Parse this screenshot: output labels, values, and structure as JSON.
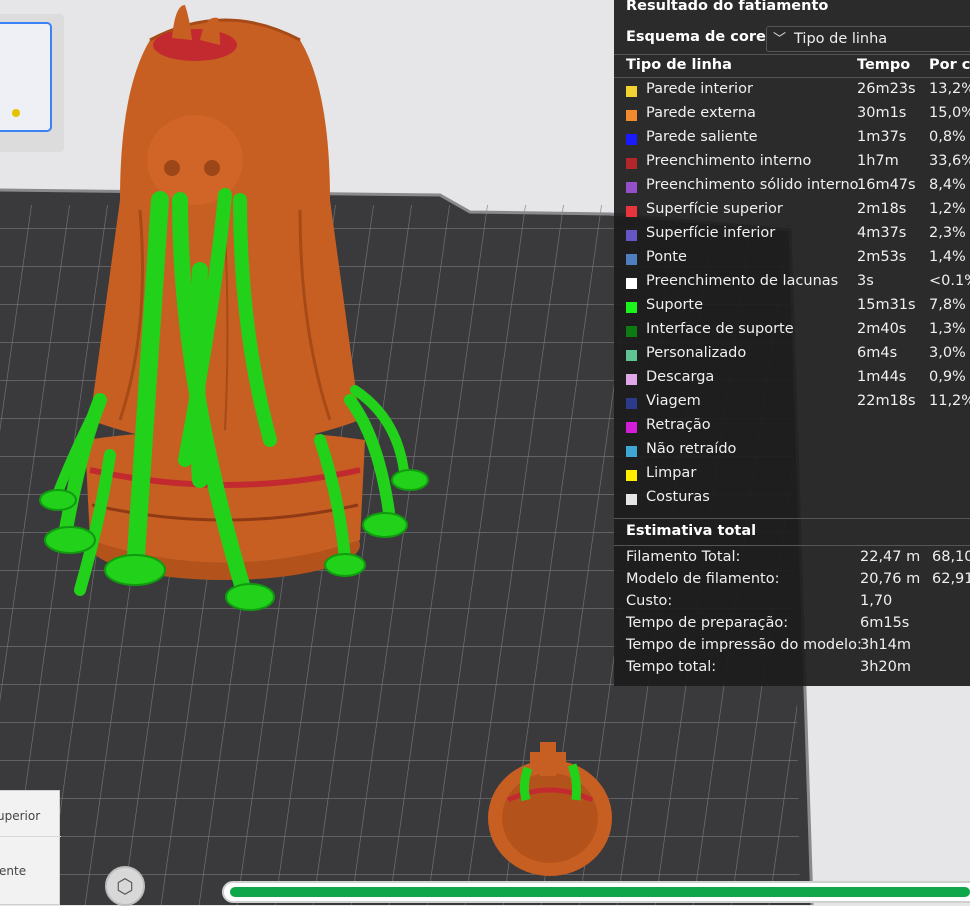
{
  "panel": {
    "title": "Resultado do fatiamento",
    "color_scheme_label": "Esquema de cores",
    "color_scheme_value": "Tipo de linha",
    "headers": {
      "line_type": "Tipo de linha",
      "time": "Tempo",
      "percent": "Por ce"
    },
    "rows": [
      {
        "label": "Parede interior",
        "time": "26m23s",
        "percent": "13,2%",
        "color": "#f2d233"
      },
      {
        "label": "Parede externa",
        "time": "30m1s",
        "percent": "15,0%",
        "color": "#f28a2e"
      },
      {
        "label": "Parede saliente",
        "time": "1m37s",
        "percent": "0,8%",
        "color": "#1a1aff"
      },
      {
        "label": "Preenchimento interno",
        "time": "1h7m",
        "percent": "33,6%",
        "color": "#b3262c"
      },
      {
        "label": "Preenchimento sólido interno",
        "time": "16m47s",
        "percent": "8,4%",
        "color": "#9450c8"
      },
      {
        "label": "Superfície superior",
        "time": "2m18s",
        "percent": "1,2%",
        "color": "#e8343d"
      },
      {
        "label": "Superfície inferior",
        "time": "4m37s",
        "percent": "2,3%",
        "color": "#6655c4"
      },
      {
        "label": "Ponte",
        "time": "2m53s",
        "percent": "1,4%",
        "color": "#4f7fbf"
      },
      {
        "label": "Preenchimento de lacunas",
        "time": "3s",
        "percent": "<0.1%",
        "color": "#ffffff"
      },
      {
        "label": "Suporte",
        "time": "15m31s",
        "percent": "7,8%",
        "color": "#1cf21c"
      },
      {
        "label": "Interface de suporte",
        "time": "2m40s",
        "percent": "1,3%",
        "color": "#0d7a12"
      },
      {
        "label": "Personalizado",
        "time": "6m4s",
        "percent": "3,0%",
        "color": "#5ec493"
      },
      {
        "label": "Descarga",
        "time": "1m44s",
        "percent": "0,9%",
        "color": "#dfa6e8"
      },
      {
        "label": "Viagem",
        "time": "22m18s",
        "percent": "11,2%",
        "color": "#2c3a8c"
      },
      {
        "label": "Retração",
        "time": "",
        "percent": "",
        "color": "#d21ed8"
      },
      {
        "label": "Não retraído",
        "time": "",
        "percent": "",
        "color": "#3fa7d6"
      },
      {
        "label": "Limpar",
        "time": "",
        "percent": "",
        "color": "#ffee00"
      },
      {
        "label": "Costuras",
        "time": "",
        "percent": "",
        "color": "#e6e6e6"
      }
    ],
    "total_title": "Estimativa total",
    "summary": [
      {
        "label": "Filamento Total:",
        "value": "22,47 m",
        "value2": "68,10"
      },
      {
        "label": "Modelo de filamento:",
        "value": "20,76 m",
        "value2": "62,91"
      },
      {
        "label": "Custo:",
        "value": "1,70",
        "value2": ""
      },
      {
        "label": "Tempo de preparação:",
        "value": "6m15s",
        "value2": ""
      },
      {
        "label": "Tempo de impressão do modelo:",
        "value": "3h14m",
        "value2": ""
      },
      {
        "label": "Tempo total:",
        "value": "3h20m",
        "value2": ""
      }
    ]
  },
  "view_cube": {
    "top_label": "uperior",
    "front_label": "ente"
  },
  "progress": {
    "fraction": 1.0,
    "color": "#10a64a"
  },
  "colors": {
    "plate": "#3a3a3c",
    "grid": "#77777a",
    "model_orange": "#c85f22",
    "support_green": "#22d11a"
  }
}
